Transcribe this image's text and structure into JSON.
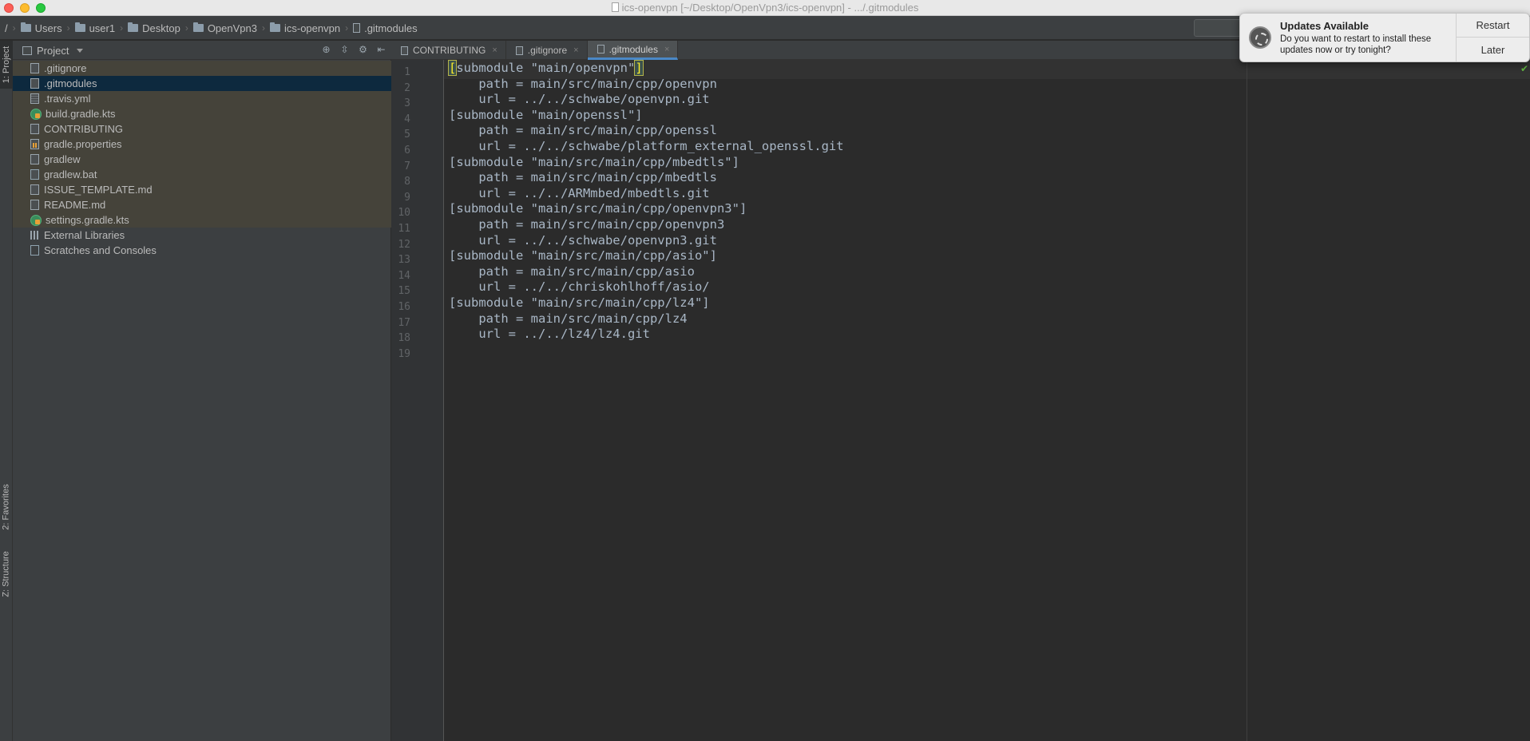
{
  "window": {
    "title": "ics-openvpn [~/Desktop/OpenVpn3/ics-openvpn] - .../.gitmodules"
  },
  "breadcrumb": {
    "items": [
      {
        "label": "/",
        "kind": "root"
      },
      {
        "label": "Users",
        "kind": "folder"
      },
      {
        "label": "user1",
        "kind": "folder"
      },
      {
        "label": "Desktop",
        "kind": "folder"
      },
      {
        "label": "OpenVpn3",
        "kind": "folder"
      },
      {
        "label": "ics-openvpn",
        "kind": "folder"
      },
      {
        "label": ".gitmodules",
        "kind": "file"
      }
    ]
  },
  "tool_strip": {
    "project": "1: Project",
    "favorites": "2: Favorites",
    "structure": "Z: Structure"
  },
  "project_panel": {
    "title": "Project",
    "items": [
      {
        "label": ".gitignore",
        "icon": "text-file-icon",
        "state": "tan"
      },
      {
        "label": ".gitmodules",
        "icon": "text-file-icon",
        "state": "selected"
      },
      {
        "label": ".travis.yml",
        "icon": "yml-file-icon",
        "state": "tan"
      },
      {
        "label": "build.gradle.kts",
        "icon": "gradle-file-icon",
        "state": "tan"
      },
      {
        "label": "CONTRIBUTING",
        "icon": "text-file-icon",
        "state": "tan"
      },
      {
        "label": "gradle.properties",
        "icon": "properties-file-icon",
        "state": "tan"
      },
      {
        "label": "gradlew",
        "icon": "text-file-icon",
        "state": "tan"
      },
      {
        "label": "gradlew.bat",
        "icon": "bat-file-icon",
        "state": "tan"
      },
      {
        "label": "ISSUE_TEMPLATE.md",
        "icon": "text-file-icon",
        "state": "tan"
      },
      {
        "label": "README.md",
        "icon": "text-file-icon",
        "state": "tan"
      },
      {
        "label": "settings.gradle.kts",
        "icon": "gradle-file-icon",
        "state": "tan"
      },
      {
        "label": "External Libraries",
        "icon": "libraries-icon",
        "state": "normal"
      },
      {
        "label": "Scratches and Consoles",
        "icon": "scratches-icon",
        "state": "normal"
      }
    ]
  },
  "editor": {
    "tabs": [
      {
        "label": "CONTRIBUTING",
        "active": false
      },
      {
        "label": ".gitignore",
        "active": false
      },
      {
        "label": ".gitmodules",
        "active": true
      }
    ],
    "lines": [
      "[submodule \"main/openvpn\"]",
      "    path = main/src/main/cpp/openvpn",
      "    url = ../../schwabe/openvpn.git",
      "[submodule \"main/openssl\"]",
      "    path = main/src/main/cpp/openssl",
      "    url = ../../schwabe/platform_external_openssl.git",
      "[submodule \"main/src/main/cpp/mbedtls\"]",
      "    path = main/src/main/cpp/mbedtls",
      "    url = ../../ARMmbed/mbedtls.git",
      "[submodule \"main/src/main/cpp/openvpn3\"]",
      "    path = main/src/main/cpp/openvpn3",
      "    url = ../../schwabe/openvpn3.git",
      "[submodule \"main/src/main/cpp/asio\"]",
      "    path = main/src/main/cpp/asio",
      "    url = ../../chriskohlhoff/asio/",
      "[submodule \"main/src/main/cpp/lz4\"]",
      "    path = main/src/main/cpp/lz4",
      "    url = ../../lz4/lz4.git",
      ""
    ]
  },
  "notification": {
    "title": "Updates Available",
    "body": "Do you want to restart to install these updates now or try tonight?",
    "restart_label": "Restart",
    "later_label": "Later"
  },
  "colors": {
    "accent": "#4a88c7",
    "selection": "#0d293e",
    "vcs_tan": "#45433a"
  }
}
